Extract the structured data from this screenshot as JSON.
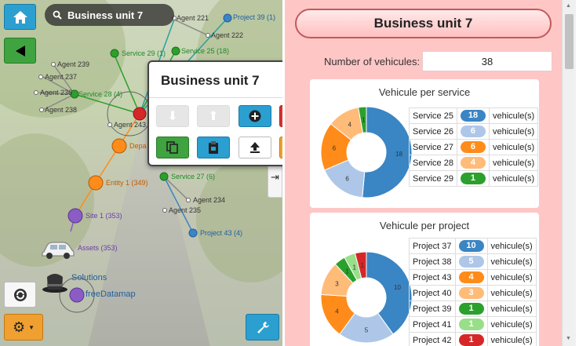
{
  "search": {
    "value": "Business unit 7"
  },
  "graph_labels": [
    {
      "text": "Agent 221",
      "cls": ""
    },
    {
      "text": "Project 39 (1)",
      "cls": "blue"
    },
    {
      "text": "Agent 222",
      "cls": ""
    },
    {
      "text": "Service 29 (1)",
      "cls": "green"
    },
    {
      "text": "Service 25 (18)",
      "cls": "green"
    },
    {
      "text": "Agent 239",
      "cls": ""
    },
    {
      "text": "Agent 237",
      "cls": ""
    },
    {
      "text": "Agent 236",
      "cls": ""
    },
    {
      "text": "Service 28 (4)",
      "cls": "green"
    },
    {
      "text": "Agent 238",
      "cls": ""
    },
    {
      "text": "Agent 243",
      "cls": ""
    },
    {
      "text": "Depa",
      "cls": "orange"
    },
    {
      "text": "Entity 1 (349)",
      "cls": "orange"
    },
    {
      "text": "Site 1 (353)",
      "cls": "purple"
    },
    {
      "text": "Service 27 (6)",
      "cls": "green"
    },
    {
      "text": "Agent 234",
      "cls": ""
    },
    {
      "text": "Agent 235",
      "cls": ""
    },
    {
      "text": "Project 43 (4)",
      "cls": "blue"
    },
    {
      "text": "Assets (353)",
      "cls": "purple"
    },
    {
      "text": "Solutions",
      "cls": "blue"
    },
    {
      "text": "freeDatamap",
      "cls": "blue"
    }
  ],
  "popup": {
    "title": "Business unit 7"
  },
  "panel": {
    "title": "Business unit 7",
    "num_vehicules_label": "Number of vehicules:",
    "num_vehicules_value": "38",
    "unit_label": "vehicule(s)"
  },
  "colors": {
    "blue": "#3a85c4",
    "lightblue": "#aec7e8",
    "orange": "#ff8c1a",
    "lightorange": "#ffbb78",
    "green": "#2ca02c",
    "lightgreen": "#98df8a",
    "red": "#d62728"
  },
  "chart_data": [
    {
      "type": "pie",
      "title": "Vehicule per service",
      "categories": [
        "Service 25",
        "Service 26",
        "Service 27",
        "Service 28",
        "Service 29"
      ],
      "values": [
        18,
        6,
        6,
        4,
        1
      ],
      "colors": [
        "#3a85c4",
        "#aec7e8",
        "#ff8c1a",
        "#ffbb78",
        "#2ca02c"
      ]
    },
    {
      "type": "pie",
      "title": "Vehicule per project",
      "categories": [
        "Project 37",
        "Project 38",
        "Project 43",
        "Project 40",
        "Project 39",
        "Project 41",
        "Project 42"
      ],
      "values": [
        10,
        5,
        4,
        3,
        1,
        1,
        1
      ],
      "colors": [
        "#3a85c4",
        "#aec7e8",
        "#ff8c1a",
        "#ffbb78",
        "#2ca02c",
        "#98df8a",
        "#d62728"
      ]
    }
  ]
}
